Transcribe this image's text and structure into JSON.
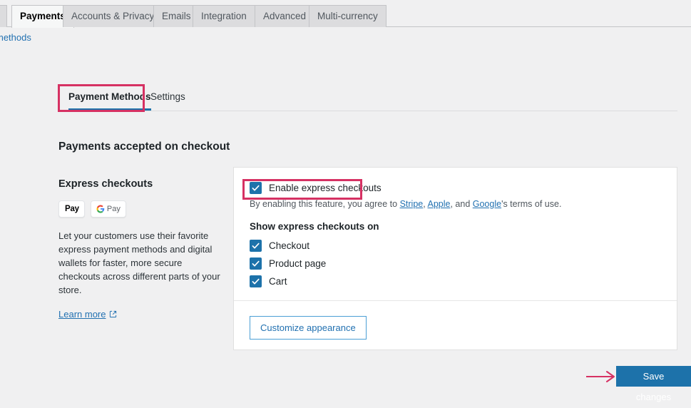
{
  "top_nav": {
    "tabs": [
      {
        "label": "Payments",
        "active": true
      },
      {
        "label": "Accounts & Privacy",
        "active": false
      },
      {
        "label": "Emails",
        "active": false
      },
      {
        "label": "Integration",
        "active": false
      },
      {
        "label": "Advanced",
        "active": false
      },
      {
        "label": "Multi-currency",
        "active": false
      }
    ]
  },
  "breadcrumb": {
    "partial_link": "methods"
  },
  "inner_tabs": {
    "payment_methods": "Payment Methods",
    "settings": "Settings"
  },
  "section": {
    "title": "Payments accepted on checkout"
  },
  "express": {
    "heading": "Express checkouts",
    "badges": [
      {
        "name": "apple-pay",
        "label": "Pay"
      },
      {
        "name": "google-pay",
        "label": "Pay"
      }
    ],
    "description": "Let your customers use their favorite express payment methods and digital wallets for faster, more secure checkouts across different parts of your store.",
    "learn_more": "Learn more"
  },
  "card": {
    "enable": {
      "label": "Enable express checkouts",
      "checked": true
    },
    "terms": {
      "prefix": "By enabling this feature, you agree to ",
      "link1": "Stripe",
      "sep1": ", ",
      "link2": "Apple",
      "sep2": ", and ",
      "link3": "Google",
      "suffix": "'s terms of use."
    },
    "show_on_label": "Show express checkouts on",
    "show_on": [
      {
        "label": "Checkout",
        "checked": true
      },
      {
        "label": "Product page",
        "checked": true
      },
      {
        "label": "Cart",
        "checked": true
      }
    ],
    "customize_button": "Customize appearance"
  },
  "footer": {
    "save_button": "Save changes"
  },
  "colors": {
    "accent_blue": "#1d72aa",
    "link_blue": "#2271b1",
    "annotation_pink": "#d63163",
    "page_bg": "#f0f0f1"
  }
}
